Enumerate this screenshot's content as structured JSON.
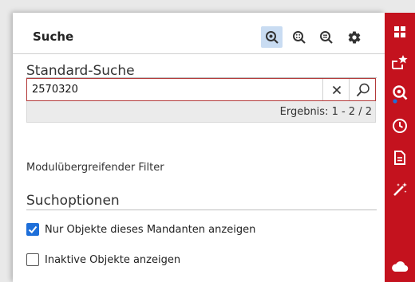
{
  "header": {
    "title": "Suche",
    "buttons": [
      {
        "name": "search-standard",
        "icon": "search-dot-icon",
        "active": true
      },
      {
        "name": "search-extended",
        "icon": "search-grid-icon",
        "active": false
      },
      {
        "name": "search-list",
        "icon": "search-list-icon",
        "active": false
      },
      {
        "name": "settings",
        "icon": "gear-icon",
        "active": false
      }
    ]
  },
  "standard_search": {
    "title": "Standard-Suche",
    "query": "2570320",
    "result": "Ergebnis: 1 - 2 / 2"
  },
  "filter_label": "Modulübergreifender Filter",
  "options": {
    "title": "Suchoptionen",
    "items": [
      {
        "label": "Nur Objekte dieses Mandanten anzeigen",
        "checked": true
      },
      {
        "label": "Inaktive Objekte anzeigen",
        "checked": false
      }
    ]
  },
  "rail": {
    "items": [
      {
        "icon": "apps-grid-icon"
      },
      {
        "icon": "favorites-icon"
      },
      {
        "icon": "search-icon",
        "active": true
      },
      {
        "icon": "clock-icon"
      },
      {
        "icon": "document-icon"
      },
      {
        "icon": "magic-wand-icon"
      },
      {
        "icon": "cloud-icon"
      }
    ]
  },
  "colors": {
    "accent_red": "#c4121e",
    "active_blue": "#1e6fd9",
    "active_bg": "#c9dcf2"
  }
}
